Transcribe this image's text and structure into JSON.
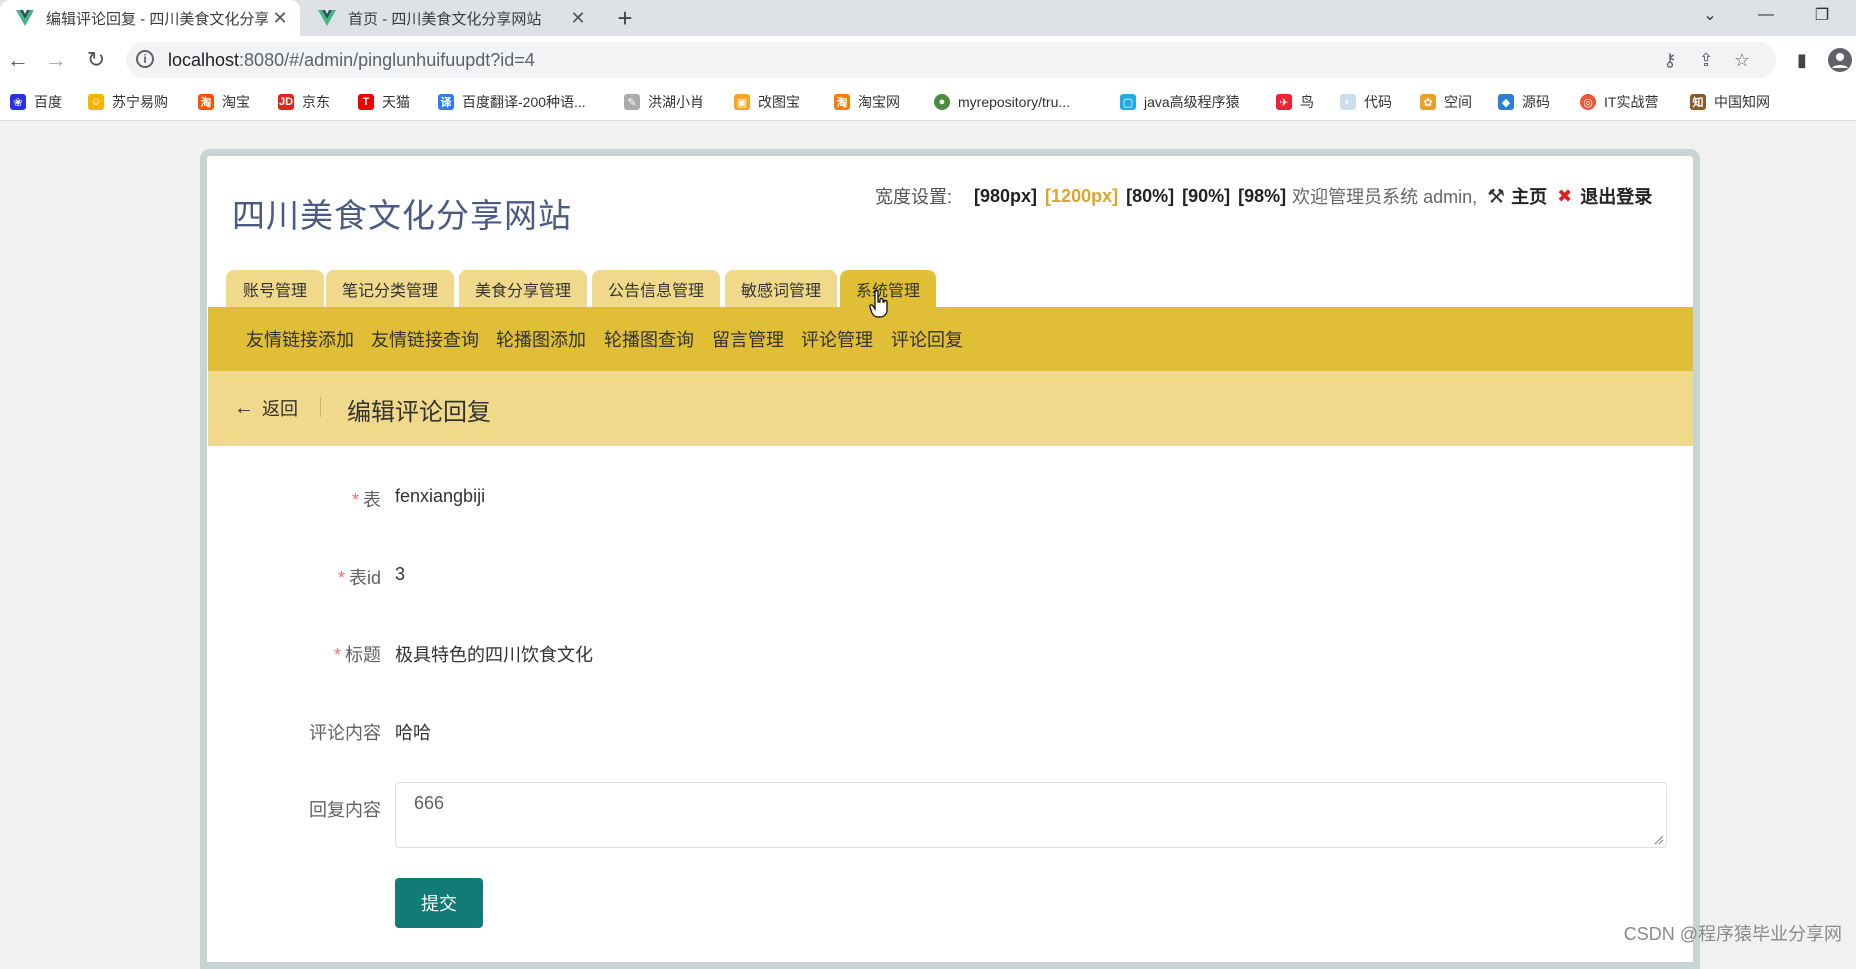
{
  "browser": {
    "tabs": [
      {
        "title": "编辑评论回复 - 四川美食文化分享",
        "active": true
      },
      {
        "title": "首页 - 四川美食文化分享网站",
        "active": false
      }
    ],
    "new_tab": "+",
    "url_host": "localhost",
    "url_rest": ":8080/#/admin/pinglunhuifuupdt?id=4",
    "bookmarks": [
      "百度",
      "苏宁易购",
      "淘宝",
      "京东",
      "天猫",
      "百度翻译-200种语...",
      "洪湖小肖",
      "改图宝",
      "淘宝网",
      "myrepository/tru...",
      "java高级程序猿",
      "鸟",
      "代码",
      "空间",
      "源码",
      "IT实战营",
      "中国知网"
    ]
  },
  "site": {
    "title": "四川美食文化分享网站",
    "width_label": "宽度设置:",
    "width_options": [
      "[980px]",
      "[1200px]",
      "[80%]",
      "[90%]",
      "[98%]"
    ],
    "welcome": "欢迎管理员系统 admin,",
    "home_link": "主页",
    "logout_link": "退出登录",
    "accent_color": "#e0be36",
    "selected_width_color": "#d9a62e"
  },
  "main_nav": [
    "账号管理",
    "笔记分类管理",
    "美食分享管理",
    "公告信息管理",
    "敏感词管理",
    "系统管理"
  ],
  "sub_nav": [
    "友情链接添加",
    "友情链接查询",
    "轮播图添加",
    "轮播图查询",
    "留言管理",
    "评论管理",
    "评论回复"
  ],
  "page_header": {
    "back": "返回",
    "title": "编辑评论回复"
  },
  "form": {
    "required_mark": "*",
    "fields": [
      {
        "label": "表",
        "value": "fenxiangbiji",
        "required": true
      },
      {
        "label": "表id",
        "value": "3",
        "required": true
      },
      {
        "label": "标题",
        "value": "极具特色的四川饮食文化",
        "required": true
      },
      {
        "label": "评论内容",
        "value": "哈哈",
        "required": false
      }
    ],
    "reply_label": "回复内容",
    "reply_value": "666",
    "submit": "提交"
  },
  "watermark": "CSDN @程序猿毕业分享网"
}
